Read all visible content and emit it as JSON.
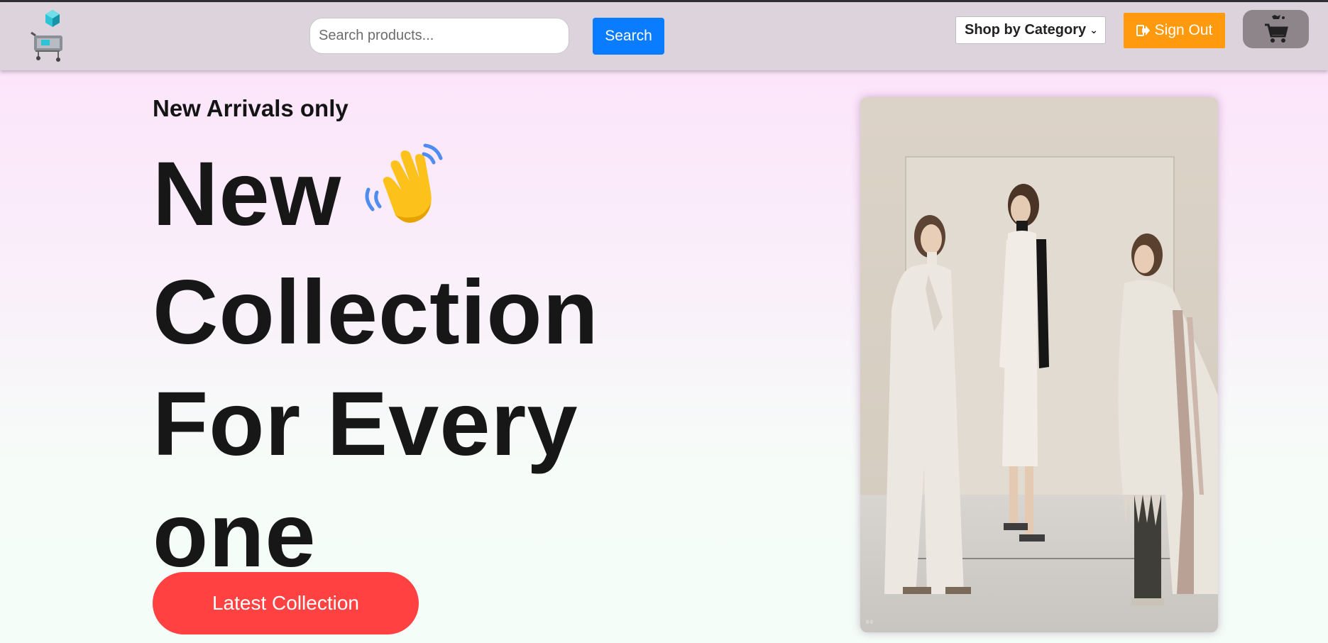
{
  "navbar": {
    "logo_icon": "shopping-cart-cube-logo",
    "search": {
      "placeholder": "Search products...",
      "value": ""
    },
    "search_button": "Search",
    "category_select": {
      "selected": "Shop by Category"
    },
    "sign_out_label": "Sign Out",
    "sign_out_icon": "sign-out-icon",
    "cart_icon": "shopping-cart-icon"
  },
  "hero": {
    "kicker": "New Arrivals only",
    "title_lines": [
      "New",
      "Collection",
      "For Every",
      "one"
    ],
    "wave_icon": "waving-hand-icon",
    "cta_label": "Latest Collection",
    "image": "fashion-models-photo"
  },
  "colors": {
    "navbar_bg": "#dcd3dd",
    "search_button": "#0a7cff",
    "sign_out_button": "#ff9a0f",
    "cart_button": "#8d8589",
    "cta_button": "#ff4141",
    "hero_gradient_top": "#fce1fb",
    "hero_gradient_bottom": "#f4fdf8"
  }
}
